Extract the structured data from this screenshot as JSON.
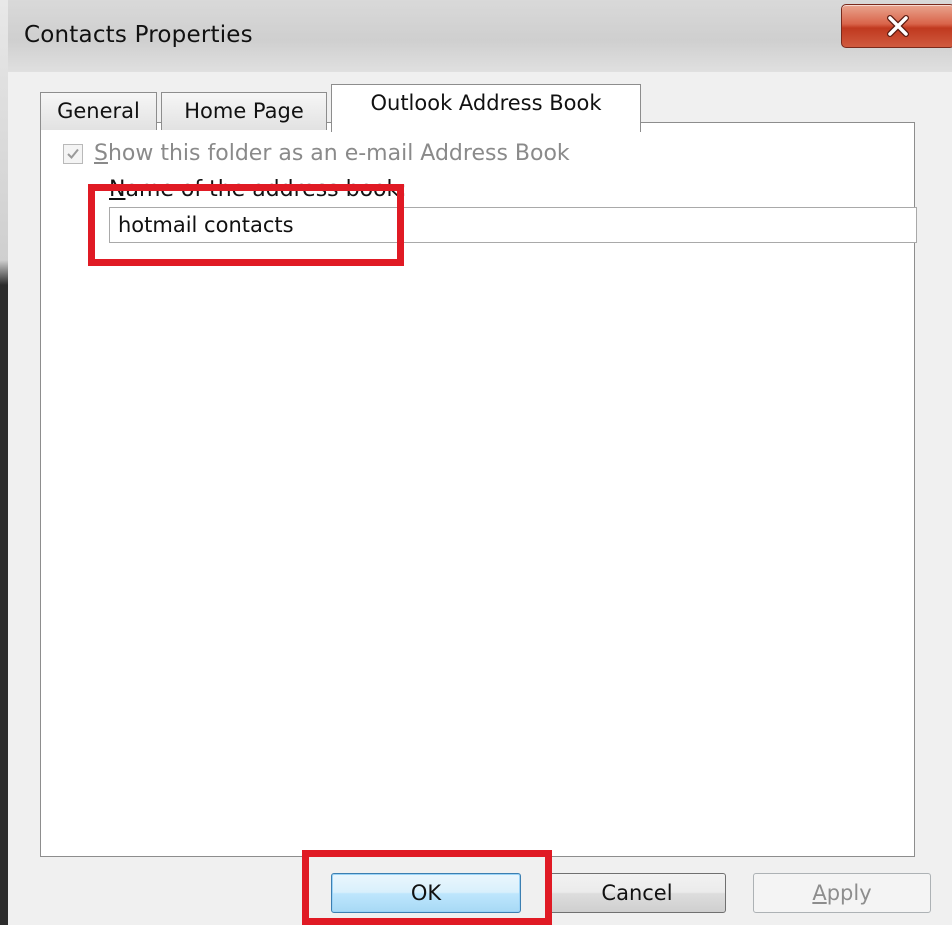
{
  "window": {
    "title": "Contacts Properties",
    "close_icon": "close-icon"
  },
  "tabs": [
    {
      "label": "General",
      "active": false
    },
    {
      "label": "Home Page",
      "active": false
    },
    {
      "label": "Outlook Address Book",
      "active": true
    }
  ],
  "panel": {
    "checkbox": {
      "label_accel": "S",
      "label_rest": "how this folder as an e-mail Address Book",
      "checked": true,
      "enabled": false
    },
    "name_label_accel": "N",
    "name_label_rest": "ame of the address book:",
    "name_value": "hotmail contacts"
  },
  "buttons": {
    "ok": "OK",
    "cancel": "Cancel",
    "apply_accel": "A",
    "apply_rest": "pply"
  },
  "colors": {
    "highlight": "#e01a24",
    "close_button": "#c0391f"
  }
}
